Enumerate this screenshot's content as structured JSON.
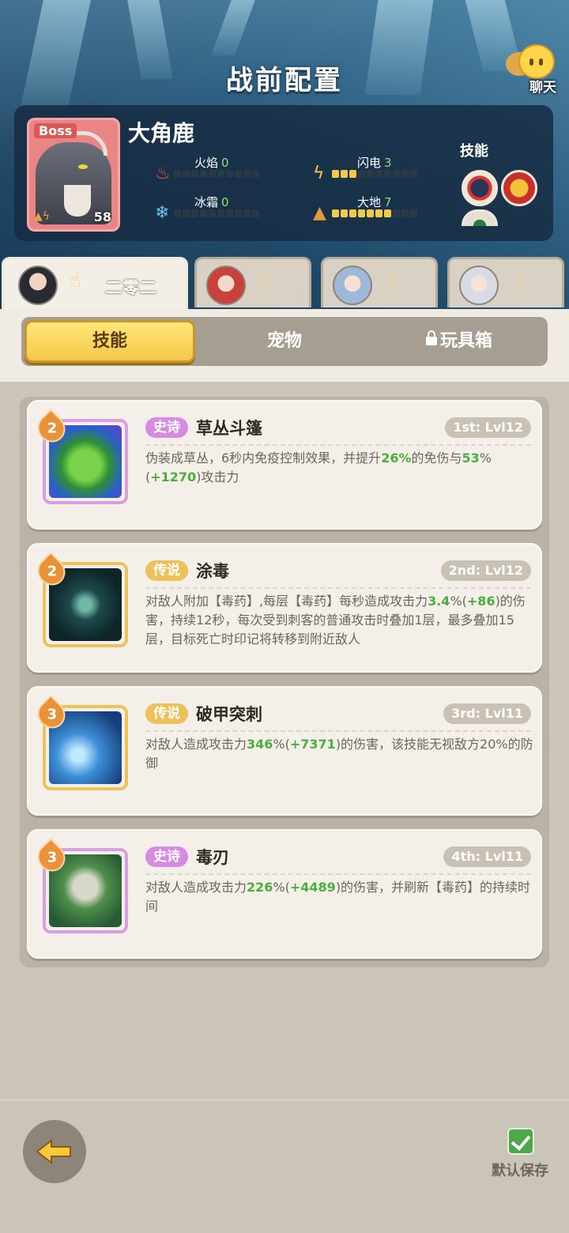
{
  "header": {
    "title": "战前配置",
    "chat_label": "聊天"
  },
  "boss": {
    "tag": "Boss",
    "name": "大角鹿",
    "level": "58",
    "skills_label": "技能",
    "stats": [
      {
        "label": "火焰",
        "value": "0",
        "filled": 0,
        "icon": "fire-icon",
        "color": "#e25a3a"
      },
      {
        "label": "闪电",
        "value": "3",
        "filled": 3,
        "icon": "lightning-icon",
        "color": "#f3c945"
      },
      {
        "label": "冰霜",
        "value": "0",
        "filled": 0,
        "icon": "frost-icon",
        "color": "#6cc4ef"
      },
      {
        "label": "大地",
        "value": "7",
        "filled": 7,
        "icon": "earth-icon",
        "color": "#e39a3a"
      }
    ]
  },
  "heroes": [
    {
      "name": "二零二",
      "active": true
    },
    {
      "name": "",
      "active": false
    },
    {
      "name": "",
      "active": false
    },
    {
      "name": "",
      "active": false
    }
  ],
  "segments": {
    "skills": "技能",
    "pets": "宠物",
    "toybox": "玩具箱"
  },
  "skills": [
    {
      "level": "2",
      "rarity": "史诗",
      "name": "草丛斗篷",
      "slot": "1st: Lvl12",
      "desc_parts": [
        "伪装成草丛，6秒内免疫控制效果，并提升",
        "26%",
        "的免伤与",
        "53",
        "%(",
        "+1270",
        ")攻击力"
      ]
    },
    {
      "level": "2",
      "rarity": "传说",
      "name": "涂毒",
      "slot": "2nd: Lvl12",
      "desc_parts": [
        "对敌人附加【毒药】,每层【毒药】每秒造成攻击力",
        "3.4",
        "%(",
        "+86",
        ")的伤害，持续12秒，每次受到刺客的普通攻击时叠加1层，最多叠加15层，目标死亡时印记将转移到附近敌人"
      ]
    },
    {
      "level": "3",
      "rarity": "传说",
      "name": "破甲突刺",
      "slot": "3rd: Lvl11",
      "desc_parts": [
        "对敌人造成攻击力",
        "346",
        "%(",
        "+7371",
        ")的伤害，该技能无视敌方20%的防御"
      ]
    },
    {
      "level": "3",
      "rarity": "史诗",
      "name": "毒刃",
      "slot": "4th: Lvl11",
      "desc_parts": [
        "对敌人造成攻击力",
        "226",
        "%(",
        "+4489",
        ")的伤害，并刷新【毒药】的持续时间"
      ]
    }
  ],
  "footer": {
    "save_label": "默认保存"
  }
}
